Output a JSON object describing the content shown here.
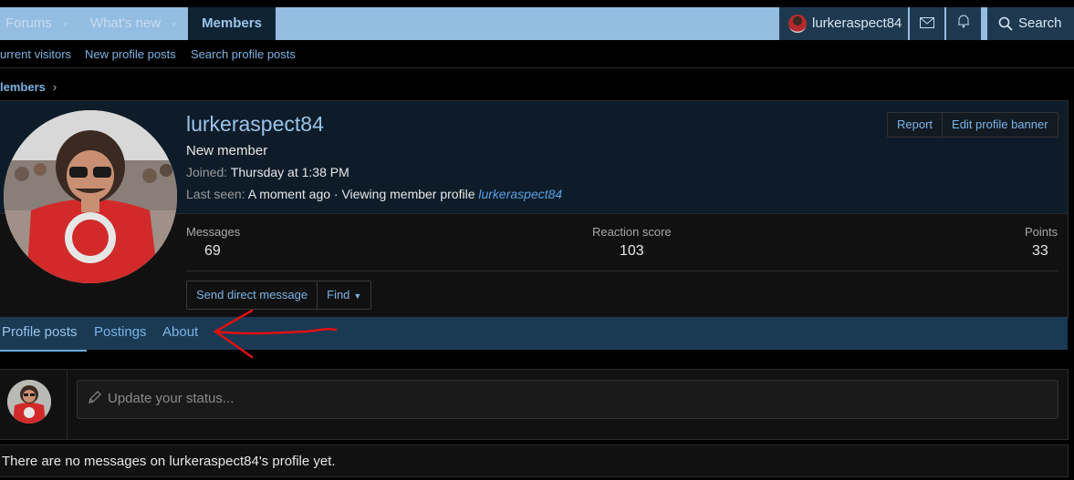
{
  "topnav": {
    "forums": "Forums",
    "whats_new": "What's new",
    "members": "Members",
    "username": "lurkeraspect84",
    "search": "Search"
  },
  "subnav": {
    "current_visitors": "urrent visitors",
    "new_profile_posts": "New profile posts",
    "search_profile_posts": "Search profile posts"
  },
  "breadcrumb": {
    "label": "lembers"
  },
  "profile": {
    "username": "lurkeraspect84",
    "title": "New member",
    "joined_label": "Joined:",
    "joined_value": "Thursday at 1:38 PM",
    "last_seen_label": "Last seen:",
    "last_seen_value": "A moment ago · Viewing member profile",
    "last_seen_link": "lurkeraspect84",
    "report": "Report",
    "edit_banner": "Edit profile banner",
    "stats": {
      "messages_label": "Messages",
      "messages_value": "69",
      "reaction_label": "Reaction score",
      "reaction_value": "103",
      "points_label": "Points",
      "points_value": "33"
    },
    "send_dm": "Send direct message",
    "find": "Find"
  },
  "tabs": {
    "profile_posts": "Profile posts",
    "postings": "Postings",
    "about": "About"
  },
  "status": {
    "placeholder": "Update your status..."
  },
  "empty_message": "There are no messages on lurkeraspect84's profile yet.",
  "colors": {
    "nav_bar": "#94bde2",
    "link": "#7ab4e6",
    "annotation_arrow": "#e01010"
  }
}
